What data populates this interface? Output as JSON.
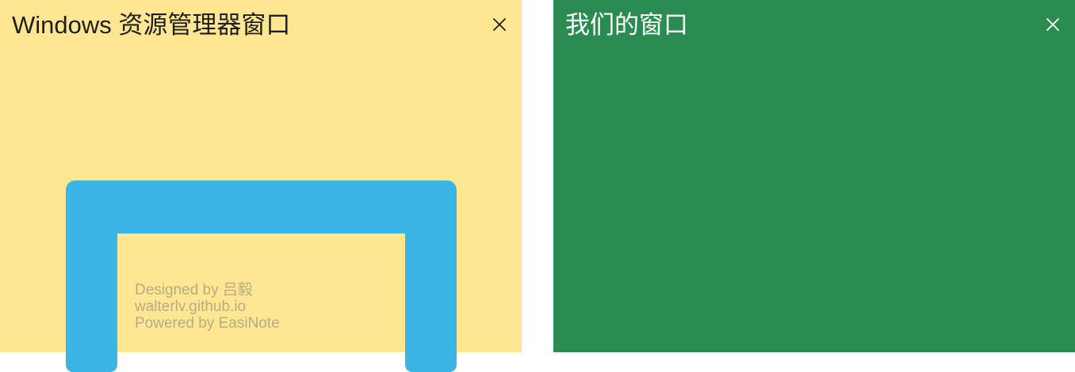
{
  "left_window": {
    "title": "Windows 资源管理器窗口",
    "close_symbol": "×",
    "background_color": "#FEE692",
    "close_icon": "close-icon"
  },
  "right_window": {
    "title": "我们的窗口",
    "close_symbol": "×",
    "background_color": "#2B8C51",
    "close_icon": "close-icon"
  },
  "arch": {
    "color": "#3BB5E6"
  },
  "credits": {
    "line1": "Designed by 吕毅",
    "line2": "walterlv.github.io",
    "line3": "Powered by EasiNote"
  }
}
